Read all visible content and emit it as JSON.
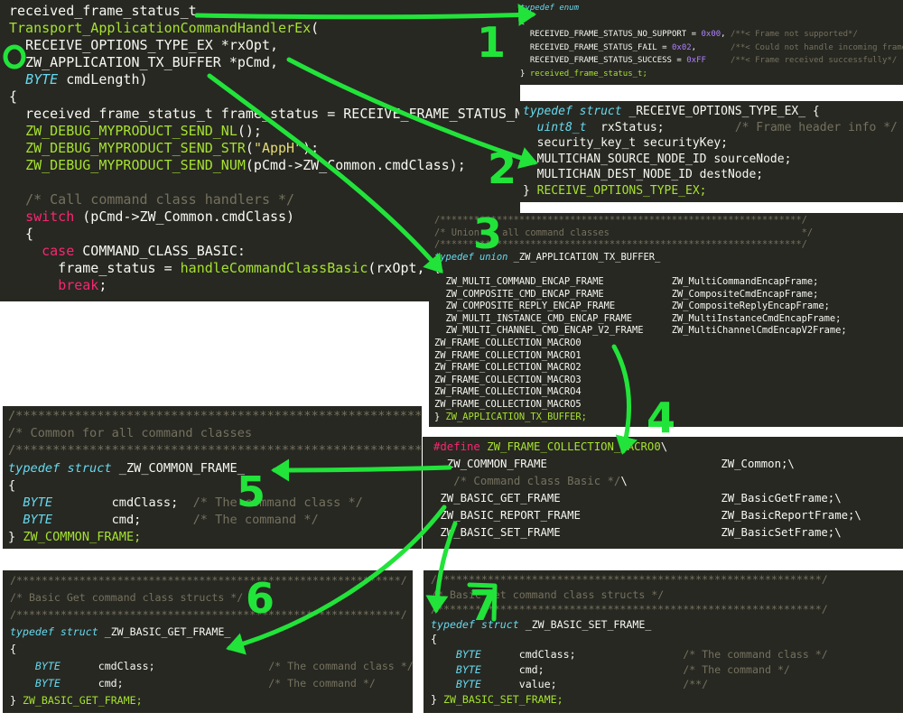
{
  "panels": {
    "handler": {
      "lines": [
        [
          {
            "t": "received_frame_status_t",
            "c": "pl"
          }
        ],
        [
          {
            "t": "Transport_ApplicationCommandHandlerEx",
            "c": "fn"
          },
          {
            "t": "(",
            "c": "pl"
          }
        ],
        [
          {
            "t": "  RECEIVE_OPTIONS_TYPE_EX *rxOpt,",
            "c": "pl"
          }
        ],
        [
          {
            "t": "  ZW_APPLICATION_TX_BUFFER *pCmd,",
            "c": "pl"
          }
        ],
        [
          {
            "t": "  ",
            "c": "pl"
          },
          {
            "t": "BYTE",
            "c": "kw"
          },
          {
            "t": " cmdLength)",
            "c": "pl"
          }
        ],
        [
          {
            "t": "{",
            "c": "pl"
          }
        ],
        [
          {
            "t": "  received_frame_status_t frame_status = RECEIVE_FRAME_STATUS_N",
            "c": "pl"
          }
        ],
        [
          {
            "t": "  ",
            "c": "pl"
          },
          {
            "t": "ZW_DEBUG_MYPRODUCT_SEND_NL",
            "c": "fn"
          },
          {
            "t": "();",
            "c": "pl"
          }
        ],
        [
          {
            "t": "  ",
            "c": "pl"
          },
          {
            "t": "ZW_DEBUG_MYPRODUCT_SEND_STR",
            "c": "fn"
          },
          {
            "t": "(",
            "c": "pl"
          },
          {
            "t": "\"AppH\"",
            "c": "str"
          },
          {
            "t": ");",
            "c": "pl"
          }
        ],
        [
          {
            "t": "  ",
            "c": "pl"
          },
          {
            "t": "ZW_DEBUG_MYPRODUCT_SEND_NUM",
            "c": "fn"
          },
          {
            "t": "(pCmd->ZW_Common.cmdClass);",
            "c": "pl"
          }
        ],
        [
          {
            "t": "",
            "c": "pl"
          }
        ],
        [
          {
            "t": "  ",
            "c": "pl"
          },
          {
            "t": "/* Call command class handlers */",
            "c": "cm"
          }
        ],
        [
          {
            "t": "  ",
            "c": "pl"
          },
          {
            "t": "switch",
            "c": "ctl"
          },
          {
            "t": " (pCmd->ZW_Common.cmdClass)",
            "c": "pl"
          }
        ],
        [
          {
            "t": "  {",
            "c": "pl"
          }
        ],
        [
          {
            "t": "    ",
            "c": "pl"
          },
          {
            "t": "case",
            "c": "ctl"
          },
          {
            "t": " COMMAND_CLASS_BASIC:",
            "c": "pl"
          }
        ],
        [
          {
            "t": "      frame_status = ",
            "c": "pl"
          },
          {
            "t": "handleCommandClassBasic",
            "c": "fn"
          },
          {
            "t": "(rxOpt, p",
            "c": "pl"
          }
        ],
        [
          {
            "t": "      ",
            "c": "pl"
          },
          {
            "t": "break",
            "c": "ctl"
          },
          {
            "t": ";",
            "c": "pl"
          }
        ]
      ]
    },
    "status_enum": {
      "lines": [
        [
          {
            "t": "typedef enum",
            "c": "kw"
          }
        ],
        [
          {
            "t": "{",
            "c": "pl"
          }
        ],
        [
          {
            "t": "  RECEIVED_FRAME_STATUS_NO_SUPPORT = ",
            "c": "pl"
          },
          {
            "t": "0x00",
            "c": "num"
          },
          {
            "t": ", ",
            "c": "pl"
          },
          {
            "t": "/**< Frame not supported*/",
            "c": "cm"
          }
        ],
        [
          {
            "t": "  RECEIVED_FRAME_STATUS_FAIL = ",
            "c": "pl"
          },
          {
            "t": "0x02",
            "c": "num"
          },
          {
            "t": ",       ",
            "c": "pl"
          },
          {
            "t": "/**< Could not handle incoming frame*/",
            "c": "cm"
          }
        ],
        [
          {
            "t": "  RECEIVED_FRAME_STATUS_SUCCESS = ",
            "c": "pl"
          },
          {
            "t": "0xFF",
            "c": "num"
          },
          {
            "t": "     ",
            "c": "pl"
          },
          {
            "t": "/**< Frame received successfully*/",
            "c": "cm"
          }
        ],
        [
          {
            "t": "} ",
            "c": "pl"
          },
          {
            "t": "received_frame_status_t;",
            "c": "tn"
          }
        ]
      ]
    },
    "rx_options": {
      "lines": [
        [
          {
            "t": "typedef struct",
            "c": "kw"
          },
          {
            "t": " _RECEIVE_OPTIONS_TYPE_EX_ {",
            "c": "pl"
          }
        ],
        [
          {
            "t": "  ",
            "c": "pl"
          },
          {
            "t": "uint8_t",
            "c": "kw"
          },
          {
            "t": "  rxStatus;          ",
            "c": "pl"
          },
          {
            "t": "/* Frame header info */",
            "c": "cm"
          }
        ],
        [
          {
            "t": "  security_key_t securityKey;",
            "c": "pl"
          }
        ],
        [
          {
            "t": "  MULTICHAN_SOURCE_NODE_ID sourceNode;",
            "c": "pl"
          }
        ],
        [
          {
            "t": "  MULTICHAN_DEST_NODE_ID destNode;",
            "c": "pl"
          }
        ],
        [
          {
            "t": "} ",
            "c": "pl"
          },
          {
            "t": "RECEIVE_OPTIONS_TYPE_EX;",
            "c": "tn"
          }
        ]
      ]
    },
    "tx_buffer": {
      "lines": [
        [
          {
            "t": "/****************************************************************/",
            "c": "cm"
          }
        ],
        [
          {
            "t": "/* Union of all command classes                                  */",
            "c": "cm"
          }
        ],
        [
          {
            "t": "/****************************************************************/",
            "c": "cm"
          }
        ],
        [
          {
            "t": "typedef union",
            "c": "kw"
          },
          {
            "t": " _ZW_APPLICATION_TX_BUFFER_",
            "c": "pl"
          }
        ],
        [
          {
            "t": "{",
            "c": "pl"
          }
        ],
        [
          {
            "t": "  ZW_MULTI_COMMAND_ENCAP_FRAME            ZW_MultiCommandEncapFrame;",
            "c": "pl"
          }
        ],
        [
          {
            "t": "  ZW_COMPOSITE_CMD_ENCAP_FRAME            ZW_CompositeCmdEncapFrame;",
            "c": "pl"
          }
        ],
        [
          {
            "t": "  ZW_COMPOSITE_REPLY_ENCAP_FRAME          ZW_CompositeReplyEncapFrame;",
            "c": "pl"
          }
        ],
        [
          {
            "t": "  ZW_MULTI_INSTANCE_CMD_ENCAP_FRAME       ZW_MultiInstanceCmdEncapFrame;",
            "c": "pl"
          }
        ],
        [
          {
            "t": "  ZW_MULTI_CHANNEL_CMD_ENCAP_V2_FRAME     ZW_MultiChannelCmdEncapV2Frame;",
            "c": "pl"
          }
        ],
        [
          {
            "t": "ZW_FRAME_COLLECTION_MACRO0",
            "c": "pl"
          }
        ],
        [
          {
            "t": "ZW_FRAME_COLLECTION_MACRO1",
            "c": "pl"
          }
        ],
        [
          {
            "t": "ZW_FRAME_COLLECTION_MACRO2",
            "c": "pl"
          }
        ],
        [
          {
            "t": "ZW_FRAME_COLLECTION_MACRO3",
            "c": "pl"
          }
        ],
        [
          {
            "t": "ZW_FRAME_COLLECTION_MACRO4",
            "c": "pl"
          }
        ],
        [
          {
            "t": "ZW_FRAME_COLLECTION_MACRO5",
            "c": "pl"
          }
        ],
        [
          {
            "t": "} ",
            "c": "pl"
          },
          {
            "t": "ZW_APPLICATION_TX_BUFFER;",
            "c": "tn"
          }
        ]
      ]
    },
    "common_frame": {
      "lines": [
        [
          {
            "t": "/*************************************************************",
            "c": "cm"
          }
        ],
        [
          {
            "t": "/* Common for all command classes",
            "c": "cm"
          }
        ],
        [
          {
            "t": "/*************************************************************",
            "c": "cm"
          }
        ],
        [
          {
            "t": "typedef struct",
            "c": "kw"
          },
          {
            "t": " _ZW_COMMON_FRAME_",
            "c": "pl"
          }
        ],
        [
          {
            "t": "{",
            "c": "pl"
          }
        ],
        [
          {
            "t": "  ",
            "c": "pl"
          },
          {
            "t": "BYTE",
            "c": "kw"
          },
          {
            "t": "        cmdClass;  ",
            "c": "pl"
          },
          {
            "t": "/* The command class */",
            "c": "cm"
          }
        ],
        [
          {
            "t": "  ",
            "c": "pl"
          },
          {
            "t": "BYTE",
            "c": "kw"
          },
          {
            "t": "        cmd;       ",
            "c": "pl"
          },
          {
            "t": "/* The command */",
            "c": "cm"
          }
        ],
        [
          {
            "t": "} ",
            "c": "pl"
          },
          {
            "t": "ZW_COMMON_FRAME;",
            "c": "tn"
          }
        ]
      ]
    },
    "macro": {
      "lines": [
        [
          {
            "t": "#define",
            "c": "pp"
          },
          {
            "t": " ",
            "c": "pl"
          },
          {
            "t": "ZW_FRAME_COLLECTION_MACRO0",
            "c": "fn"
          },
          {
            "t": "\\",
            "c": "pl"
          }
        ],
        [
          {
            "t": "  ZW_COMMON_FRAME                          ZW_Common;\\",
            "c": "pl"
          }
        ],
        [
          {
            "t": "   ",
            "c": "pl"
          },
          {
            "t": "/* Command class Basic */",
            "c": "cm"
          },
          {
            "t": "\\",
            "c": "pl"
          }
        ],
        [
          {
            "t": " ZW_BASIC_GET_FRAME                        ZW_BasicGetFrame;\\",
            "c": "pl"
          }
        ],
        [
          {
            "t": " ZW_BASIC_REPORT_FRAME                     ZW_BasicReportFrame;\\",
            "c": "pl"
          }
        ],
        [
          {
            "t": " ZW_BASIC_SET_FRAME                        ZW_BasicSetFrame;\\",
            "c": "pl"
          }
        ]
      ]
    },
    "basic_get": {
      "lines": [
        [
          {
            "t": "/*************************************************************/",
            "c": "cm"
          }
        ],
        [
          {
            "t": "/* Basic Get command class structs */",
            "c": "cm"
          }
        ],
        [
          {
            "t": "/*************************************************************/",
            "c": "cm"
          }
        ],
        [
          {
            "t": "typedef struct",
            "c": "kw"
          },
          {
            "t": " _ZW_BASIC_GET_FRAME_",
            "c": "pl"
          }
        ],
        [
          {
            "t": "{",
            "c": "pl"
          }
        ],
        [
          {
            "t": "    ",
            "c": "pl"
          },
          {
            "t": "BYTE",
            "c": "kw"
          },
          {
            "t": "      cmdClass;                  ",
            "c": "pl"
          },
          {
            "t": "/* The command class */",
            "c": "cm"
          }
        ],
        [
          {
            "t": "    ",
            "c": "pl"
          },
          {
            "t": "BYTE",
            "c": "kw"
          },
          {
            "t": "      cmd;                       ",
            "c": "pl"
          },
          {
            "t": "/* The command */",
            "c": "cm"
          }
        ],
        [
          {
            "t": "} ",
            "c": "pl"
          },
          {
            "t": "ZW_BASIC_GET_FRAME;",
            "c": "tn"
          }
        ]
      ]
    },
    "basic_set": {
      "lines": [
        [
          {
            "t": "/*************************************************************/",
            "c": "cm"
          }
        ],
        [
          {
            "t": "/* Basic Set command class structs */",
            "c": "cm"
          }
        ],
        [
          {
            "t": "/*************************************************************/",
            "c": "cm"
          }
        ],
        [
          {
            "t": "typedef struct",
            "c": "kw"
          },
          {
            "t": " _ZW_BASIC_SET_FRAME_",
            "c": "pl"
          }
        ],
        [
          {
            "t": "{",
            "c": "pl"
          }
        ],
        [
          {
            "t": "    ",
            "c": "pl"
          },
          {
            "t": "BYTE",
            "c": "kw"
          },
          {
            "t": "      cmdClass;                 ",
            "c": "pl"
          },
          {
            "t": "/* The command class */",
            "c": "cm"
          }
        ],
        [
          {
            "t": "    ",
            "c": "pl"
          },
          {
            "t": "BYTE",
            "c": "kw"
          },
          {
            "t": "      cmd;                      ",
            "c": "pl"
          },
          {
            "t": "/* The command */",
            "c": "cm"
          }
        ],
        [
          {
            "t": "    ",
            "c": "pl"
          },
          {
            "t": "BYTE",
            "c": "kw"
          },
          {
            "t": "      value;                    ",
            "c": "pl"
          },
          {
            "t": "/**/",
            "c": "cm"
          }
        ],
        [
          {
            "t": "} ",
            "c": "pl"
          },
          {
            "t": "ZW_BASIC_SET_FRAME;",
            "c": "tn"
          }
        ]
      ]
    }
  },
  "annotations": {
    "color": "#22e33a",
    "labels": [
      "1",
      "2",
      "3",
      "4",
      "5",
      "6",
      "7"
    ]
  },
  "colors": {
    "background": "#272822",
    "text": "#f8f8f2",
    "keyword": "#66d9ef",
    "control": "#f92672",
    "function": "#a6e22e",
    "string": "#e6db74",
    "comment": "#75715e",
    "number": "#ae81ff"
  }
}
